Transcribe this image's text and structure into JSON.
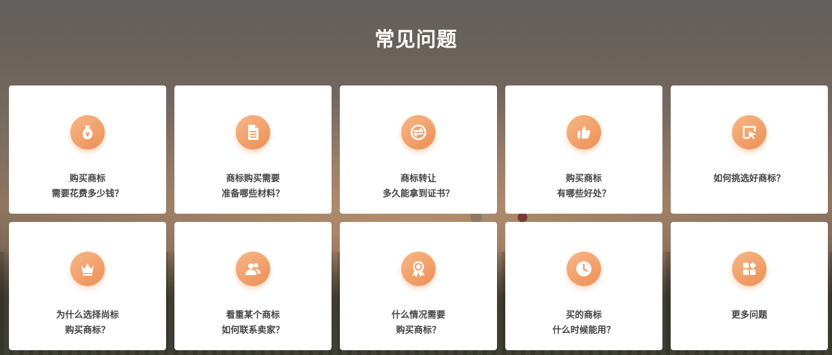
{
  "section": {
    "title": "常见问题"
  },
  "cards": [
    {
      "icon": "money-bag-icon",
      "line1": "购买商标",
      "line2": "需要花费多少钱？"
    },
    {
      "icon": "document-icon",
      "line1": "商标购买需要",
      "line2": "准备哪些材料？"
    },
    {
      "icon": "transfer-icon",
      "line1": "商标转让",
      "line2": "多久能拿到证书？"
    },
    {
      "icon": "thumbs-up-icon",
      "line1": "购买商标",
      "line2": "有哪些好处？"
    },
    {
      "icon": "pointer-select-icon",
      "line1": "如何挑选好商标？",
      "line2": ""
    },
    {
      "icon": "crown-icon",
      "line1": "为什么选择尚标",
      "line2": "购买商标？"
    },
    {
      "icon": "users-icon",
      "line1": "看重某个商标",
      "line2": "如何联系卖家？"
    },
    {
      "icon": "award-ribbon-icon",
      "line1": "什么情况需要",
      "line2": "购买商标？"
    },
    {
      "icon": "clock-icon",
      "line1": "买的商标",
      "line2": "什么时候能用？"
    },
    {
      "icon": "apps-grid-icon",
      "line1": "更多问题",
      "line2": ""
    }
  ],
  "colors": {
    "icon_gradient_start": "#f6b787",
    "icon_gradient_end": "#ee8f55",
    "card_text": "#444444"
  }
}
